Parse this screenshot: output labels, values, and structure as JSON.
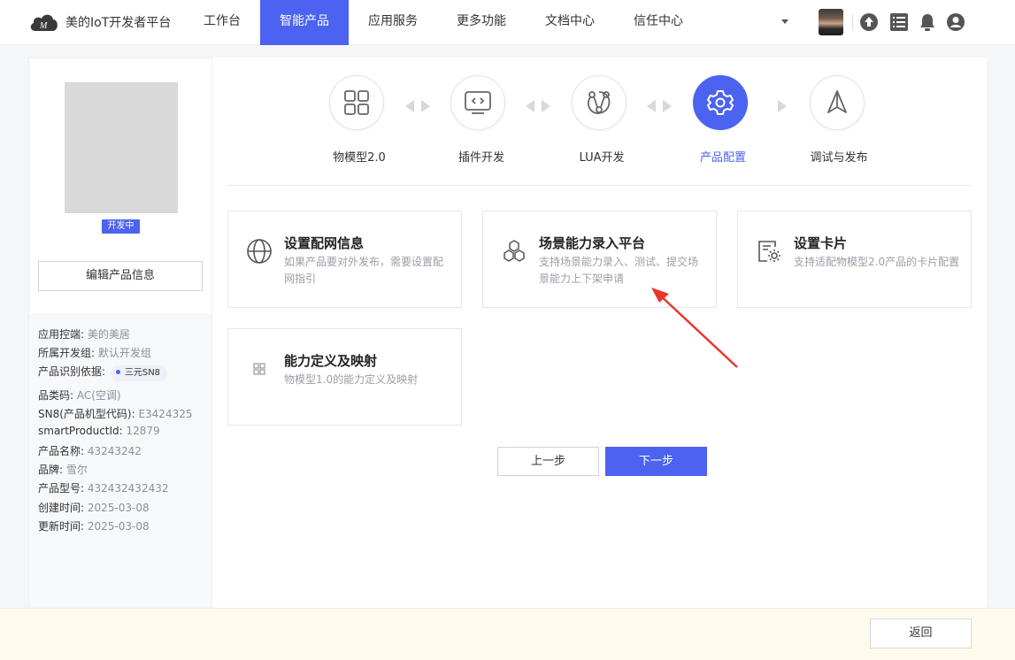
{
  "brand": {
    "name": "美的IoT开发者平台"
  },
  "nav": {
    "items": [
      {
        "label": "工作台",
        "active": false
      },
      {
        "label": "智能产品",
        "active": true
      },
      {
        "label": "应用服务",
        "active": false
      },
      {
        "label": "更多功能",
        "active": false
      },
      {
        "label": "文档中心",
        "active": false
      },
      {
        "label": "信任中心",
        "active": false
      }
    ],
    "icons": [
      "upload-icon",
      "list-icon",
      "bell-icon",
      "user-icon"
    ]
  },
  "product": {
    "status": "开发中",
    "edit_label": "编辑产品信息",
    "info": [
      {
        "label": "应用控端: ",
        "value": "美的美居"
      },
      {
        "label": "所属开发组: ",
        "value": "默认开发组"
      },
      {
        "label": "产品识别依据: ",
        "value": "",
        "tag": "三元SN8"
      },
      {
        "label": "品类码: ",
        "value": "AC(空调)"
      },
      {
        "label": "SN8(产品机型代码): ",
        "value": "E3424325"
      },
      {
        "label": "smartProductId: ",
        "value": "12879"
      },
      {
        "label": "产品名称: ",
        "value": "43243242"
      },
      {
        "label": "品牌: ",
        "value": "雪尔"
      },
      {
        "label": "产品型号: ",
        "value": "432432432432"
      },
      {
        "label": "创建时间: ",
        "value": "2025-03-08"
      },
      {
        "label": "更新时间: ",
        "value": "2025-03-08"
      }
    ]
  },
  "steps": [
    {
      "label": "物模型2.0",
      "icon": "grid-icon",
      "active": false
    },
    {
      "label": "插件开发",
      "icon": "code-monitor-icon",
      "active": false
    },
    {
      "label": "LUA开发",
      "icon": "nodes-icon",
      "active": false
    },
    {
      "label": "产品配置",
      "icon": "gear-icon",
      "active": true
    },
    {
      "label": "调试与发布",
      "icon": "send-icon",
      "active": false
    }
  ],
  "cards": [
    {
      "title": "设置配网信息",
      "desc": "如果产品要对外发布，需要设置配网指引",
      "icon": "globe-icon"
    },
    {
      "title": "场景能力录入平台",
      "desc": "支持场景能力录入、测试、提交场景能力上下架申请",
      "icon": "hexagons-icon"
    },
    {
      "title": "设置卡片",
      "desc": "支持适配物模型2.0产品的卡片配置",
      "icon": "card-settings-icon"
    },
    {
      "title": "能力定义及映射",
      "desc": "物模型1.0的能力定义及映射",
      "icon": "small-grid-icon"
    }
  ],
  "buttons": {
    "prev": "上一步",
    "next": "下一步",
    "back": "返回"
  },
  "colors": {
    "accent": "#4c62f0",
    "annotation": "#e8372c"
  }
}
